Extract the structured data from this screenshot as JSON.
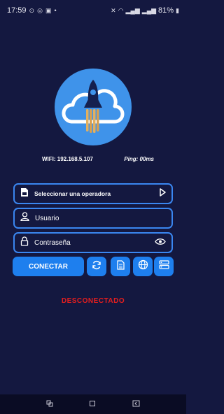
{
  "status_bar": {
    "time": "17:59",
    "battery": "81%"
  },
  "info": {
    "wifi": "WIFI: 192.168.5.107",
    "ping": "Ping: 00ms"
  },
  "operator_select": {
    "value": "Seleccionar una operadora"
  },
  "username": {
    "placeholder": "Usuario"
  },
  "password": {
    "placeholder": "Contraseña"
  },
  "buttons": {
    "connect": "CONECTAR"
  },
  "connection_state": "DESCONECTADO",
  "colors": {
    "background": "#141840",
    "accent": "#1e7fee",
    "logo": "#3f93ea",
    "error": "#e61e1e"
  },
  "icons": [
    "sim-card-icon",
    "play-arrow-icon",
    "user-icon",
    "lock-icon",
    "eye-icon",
    "refresh-icon",
    "document-icon",
    "globe-icon",
    "server-icon",
    "rocket-cloud-logo"
  ]
}
